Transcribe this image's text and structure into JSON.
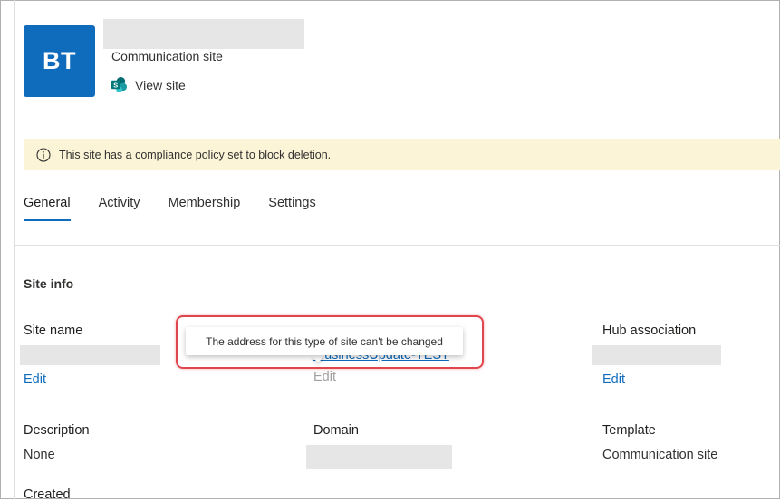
{
  "site": {
    "initials": "BT",
    "type": "Communication site",
    "view_site_label": "View site",
    "view_site_icon": "sharepoint-icon"
  },
  "banner": {
    "icon": "info-icon",
    "text": "This site has a compliance policy set to block deletion."
  },
  "tabs": [
    "General",
    "Activity",
    "Membership",
    "Settings"
  ],
  "active_tab": "General",
  "general": {
    "section_title": "Site info",
    "site_name": {
      "label": "Site name",
      "edit": "Edit"
    },
    "site_address": {
      "url_fragment": "...usinessUpdate-TEST",
      "edit": "Edit"
    },
    "hub_association": {
      "label": "Hub association",
      "edit": "Edit"
    },
    "description": {
      "label": "Description",
      "value": "None"
    },
    "domain": {
      "label": "Domain"
    },
    "template": {
      "label": "Template",
      "value": "Communication site"
    },
    "created": {
      "label": "Created"
    }
  },
  "tooltip": {
    "text": "The address for this type of site can't be changed"
  },
  "colors": {
    "accent": "#0f6cbd",
    "banner": "#fcf4d6",
    "highlight": "#e0474c"
  }
}
